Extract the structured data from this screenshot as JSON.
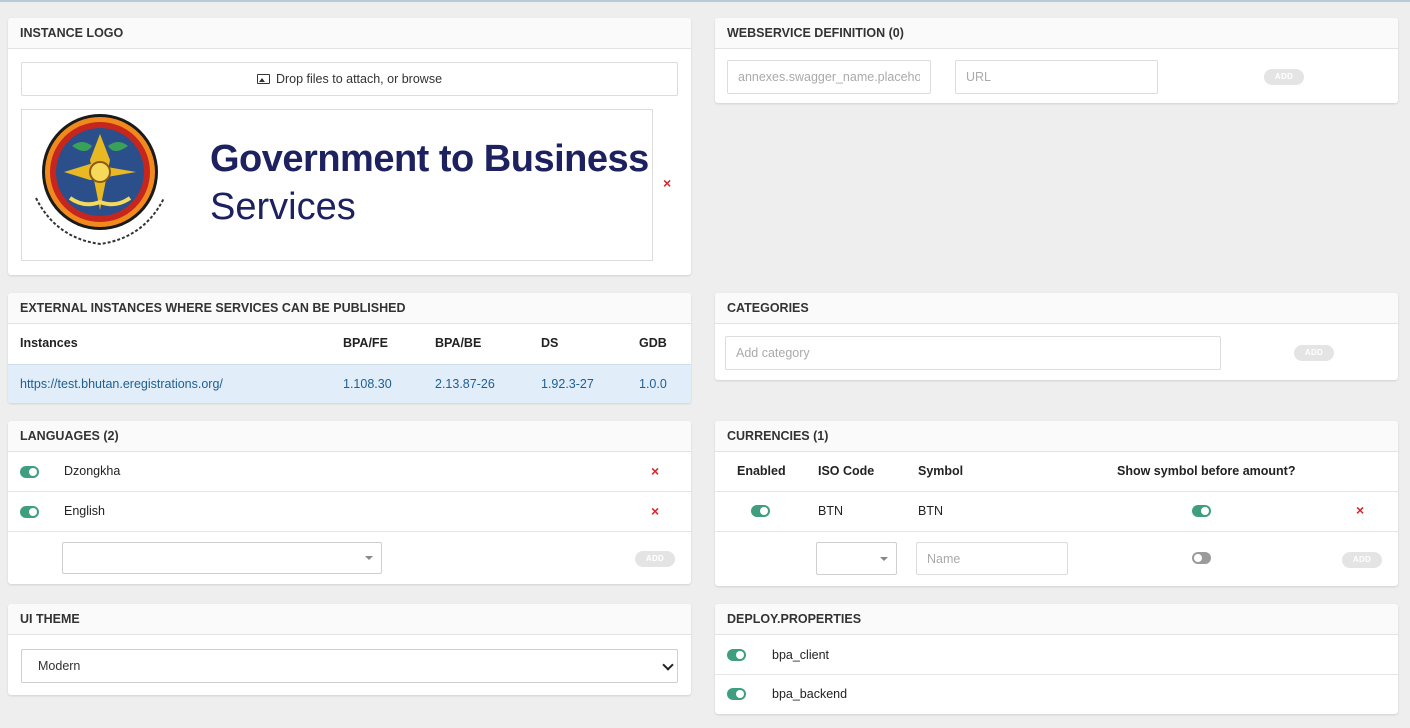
{
  "instance_logo": {
    "title": "INSTANCE LOGO",
    "dropzone_label": "Drop files to attach, or browse",
    "logo_line1": "Government to Business",
    "logo_line2": "Services",
    "remove": "×"
  },
  "webservice": {
    "title": "WEBSERVICE DEFINITION (0)",
    "name_placeholder": "annexes.swagger_name.placeho",
    "url_placeholder": "URL",
    "add_label": "ADD"
  },
  "external_instances": {
    "title": "EXTERNAL INSTANCES WHERE SERVICES CAN BE PUBLISHED",
    "columns": [
      "Instances",
      "BPA/FE",
      "BPA/BE",
      "DS",
      "GDB"
    ],
    "rows": [
      [
        "https://test.bhutan.eregistrations.org/",
        "1.108.30",
        "2.13.87-26",
        "1.92.3-27",
        "1.0.0"
      ]
    ]
  },
  "categories": {
    "title": "CATEGORIES",
    "placeholder": "Add category",
    "add_label": "ADD"
  },
  "languages": {
    "title": "LANGUAGES (2)",
    "items": [
      {
        "name": "Dzongkha",
        "enabled": true
      },
      {
        "name": "English",
        "enabled": true
      }
    ],
    "add_label": "ADD",
    "remove": "×"
  },
  "currencies": {
    "title": "CURRENCIES (1)",
    "columns": [
      "Enabled",
      "ISO Code",
      "Symbol",
      "Show symbol before amount?"
    ],
    "rows": [
      {
        "iso": "BTN",
        "symbol": "BTN",
        "enabled": true,
        "symbol_before": true
      }
    ],
    "name_placeholder": "Name",
    "add_label": "ADD",
    "remove": "×"
  },
  "ui_theme": {
    "title": "UI THEME",
    "selected": "Modern"
  },
  "deploy_properties": {
    "title": "DEPLOY.PROPERTIES",
    "items": [
      {
        "name": "bpa_client",
        "enabled": true
      },
      {
        "name": "bpa_backend",
        "enabled": true
      }
    ]
  },
  "colors": {
    "accent_toggle": "#3f9e80",
    "link": "#1f5f93",
    "danger": "#d9262b",
    "logo_text": "#1d2160"
  }
}
